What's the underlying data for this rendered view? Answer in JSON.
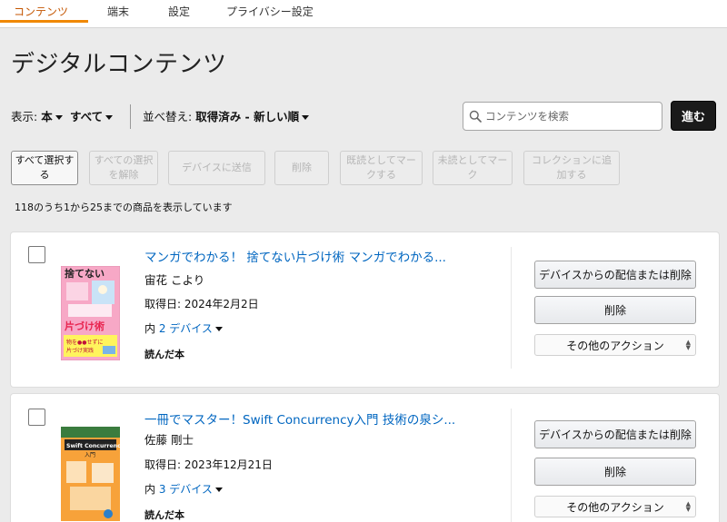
{
  "tabs": [
    {
      "label": "コンテンツ",
      "active": true
    },
    {
      "label": "端末",
      "active": false
    },
    {
      "label": "設定",
      "active": false
    },
    {
      "label": "プライバシー設定",
      "active": false
    }
  ],
  "page_title": "デジタルコンテンツ",
  "filters": {
    "show_label": "表示:",
    "show_value": "本",
    "all_value": "すべて",
    "sort_label": "並べ替え:",
    "sort_value": "取得済み - 新しい順"
  },
  "search": {
    "placeholder": "コンテンツを検索",
    "value": "",
    "go_label": "進む",
    "icon": "search-icon"
  },
  "actions": [
    {
      "label": "すべて選択す\nる",
      "enabled": true
    },
    {
      "label": "すべての選択\nを解除",
      "enabled": false
    },
    {
      "label": "デバイスに送信",
      "enabled": false
    },
    {
      "label": "削除",
      "enabled": false
    },
    {
      "label": "既読としてマー\nクする",
      "enabled": false
    },
    {
      "label": "未読としてマー\nク",
      "enabled": false
    },
    {
      "label": "コレクションに追\n加する",
      "enabled": false
    }
  ],
  "result_count": "118のうち1から25までの商品を表示しています",
  "items": [
    {
      "title": "マンガでわかる！ 捨てない片づけ術 マンガでわかる...",
      "author": "宙花 こより",
      "date": "取得日: 2024年2月2日",
      "devices_prefix": "内",
      "devices_link": "2 デバイス",
      "status": "読んだ本",
      "cover_text": "捨てない片づけ術",
      "cover_subtext": "物を●●せずに片づけ実践"
    },
    {
      "title": "一冊でマスター！Swift Concurrency入門 技術の泉シ...",
      "author": "佐藤 剛士",
      "date": "取得日: 2023年12月21日",
      "devices_prefix": "内",
      "devices_link": "3 デバイス",
      "status": "読んだ本",
      "cover_text": "Swift Concurrency",
      "cover_subtext": "入門"
    }
  ],
  "item_buttons": {
    "remove_from_device": "デバイスからの配信または削除",
    "delete": "削除",
    "more_actions": "その他のアクション"
  },
  "colors": {
    "accent_tab": "#f08804",
    "link": "#0066c0",
    "go_button": "#1a1a1a"
  }
}
